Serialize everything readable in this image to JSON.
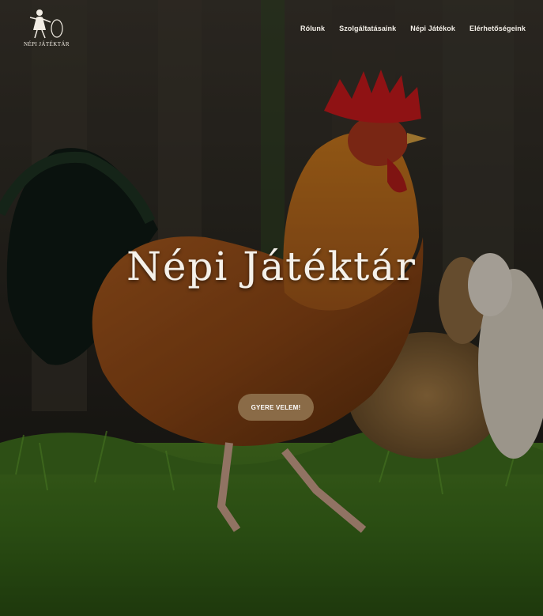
{
  "logo": {
    "text": "NÉPI JÁTÉKTÁR",
    "icon": "girl-with-hoop-icon"
  },
  "nav": {
    "items": [
      "Rólunk",
      "Szolgáltatásaink",
      "Népi Játékok",
      "Elérhetőségeink"
    ]
  },
  "hero": {
    "title": "Népi Játéktár",
    "cta_label": "GYERE VELEM!",
    "background": "rooster-photo"
  },
  "colors": {
    "cta": "#8a6b47",
    "nav_text": "#f3efe8",
    "overlay": "#000000"
  }
}
